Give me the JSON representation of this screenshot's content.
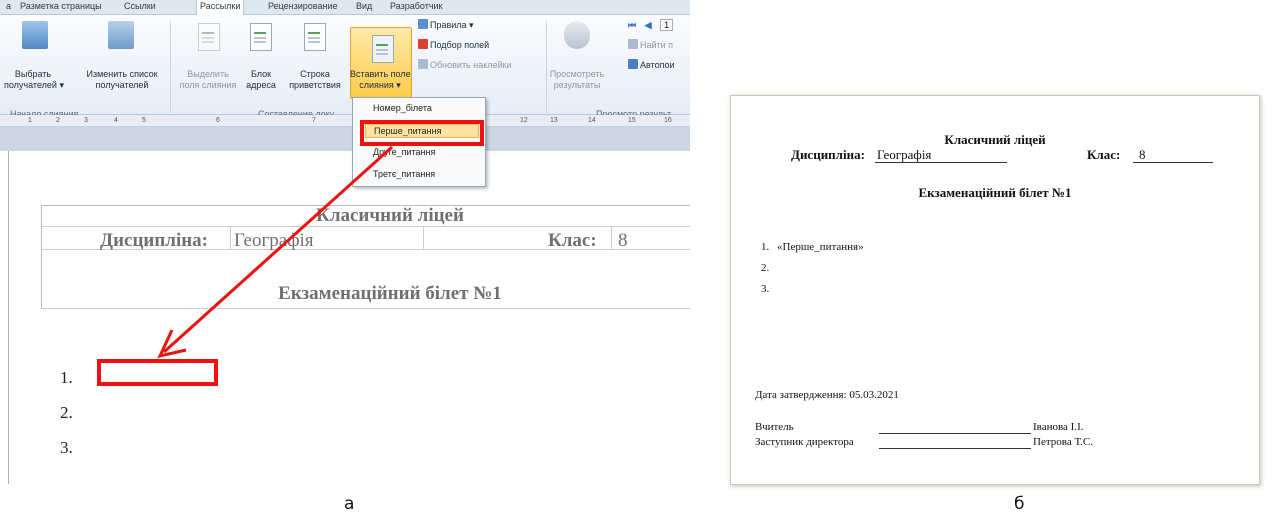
{
  "ribbon": {
    "tabs": [
      "а",
      "Разметка страницы",
      "Ссылки",
      "Рассылки",
      "Рецензирование",
      "Вид",
      "Разработчик"
    ],
    "active_tab": "Рассылки",
    "buttons": {
      "select_recipients": [
        "Выбрать",
        "получателей ▾"
      ],
      "edit_list": [
        "Изменить список",
        "получателей"
      ],
      "highlight_fields": [
        "Выделить",
        "поля слияния"
      ],
      "address_block": [
        "Блок",
        "адреса"
      ],
      "greeting_line": [
        "Строка",
        "приветствия"
      ],
      "insert_merge_field": [
        "Вставить поле",
        "слияния ▾"
      ],
      "rules": "Правила ▾",
      "match_fields": "Подбор полей",
      "update_labels": "Обновить наклейки",
      "preview_results": [
        "Просмотреть",
        "результаты"
      ],
      "record_number": "1",
      "find_recipient": "Найти п",
      "auto_check": "Автопои"
    },
    "groups": {
      "start_merge": "Начало слияния",
      "compose": "Составление доку",
      "preview": "Просмотр результ"
    }
  },
  "ruler_numbers": [
    "1",
    "2",
    "3",
    "4",
    "5",
    "6",
    "7",
    "12",
    "13",
    "14",
    "15",
    "16"
  ],
  "dropdown": {
    "items": [
      "Номер_білета",
      "Перше_питання",
      "Друге_питання",
      "Третє_питання"
    ],
    "highlighted_index": 1
  },
  "document_left": {
    "school": "Класичний ліцей",
    "discipline_label": "Дисципліна:",
    "discipline_value": "Географія",
    "class_label": "Клас:",
    "class_value": "8",
    "ticket_title": "Екзаменаційний білет №1",
    "list": [
      "1.",
      "2.",
      "3."
    ]
  },
  "document_right": {
    "school": "Класичний ліцей",
    "discipline_label": "Дисципліна:",
    "discipline_value": "Географія",
    "class_label": "Клас:",
    "class_value": "8",
    "ticket_title": "Екзаменаційний білет №1",
    "questions": [
      {
        "num": "1.",
        "text": "«Перше_питання»"
      },
      {
        "num": "2.",
        "text": ""
      },
      {
        "num": "3.",
        "text": ""
      }
    ],
    "approval_date": "Дата затвердження: 05.03.2021",
    "teacher_label": "Вчитель",
    "teacher_name": "Іванова І.І.",
    "deputy_label": "Заступник директора",
    "deputy_name": "Петрова Т.С."
  },
  "captions": {
    "left": "а",
    "right": "б"
  },
  "colors": {
    "highlight": "#ee1111",
    "ribbon_selected": "#ffd45e"
  }
}
